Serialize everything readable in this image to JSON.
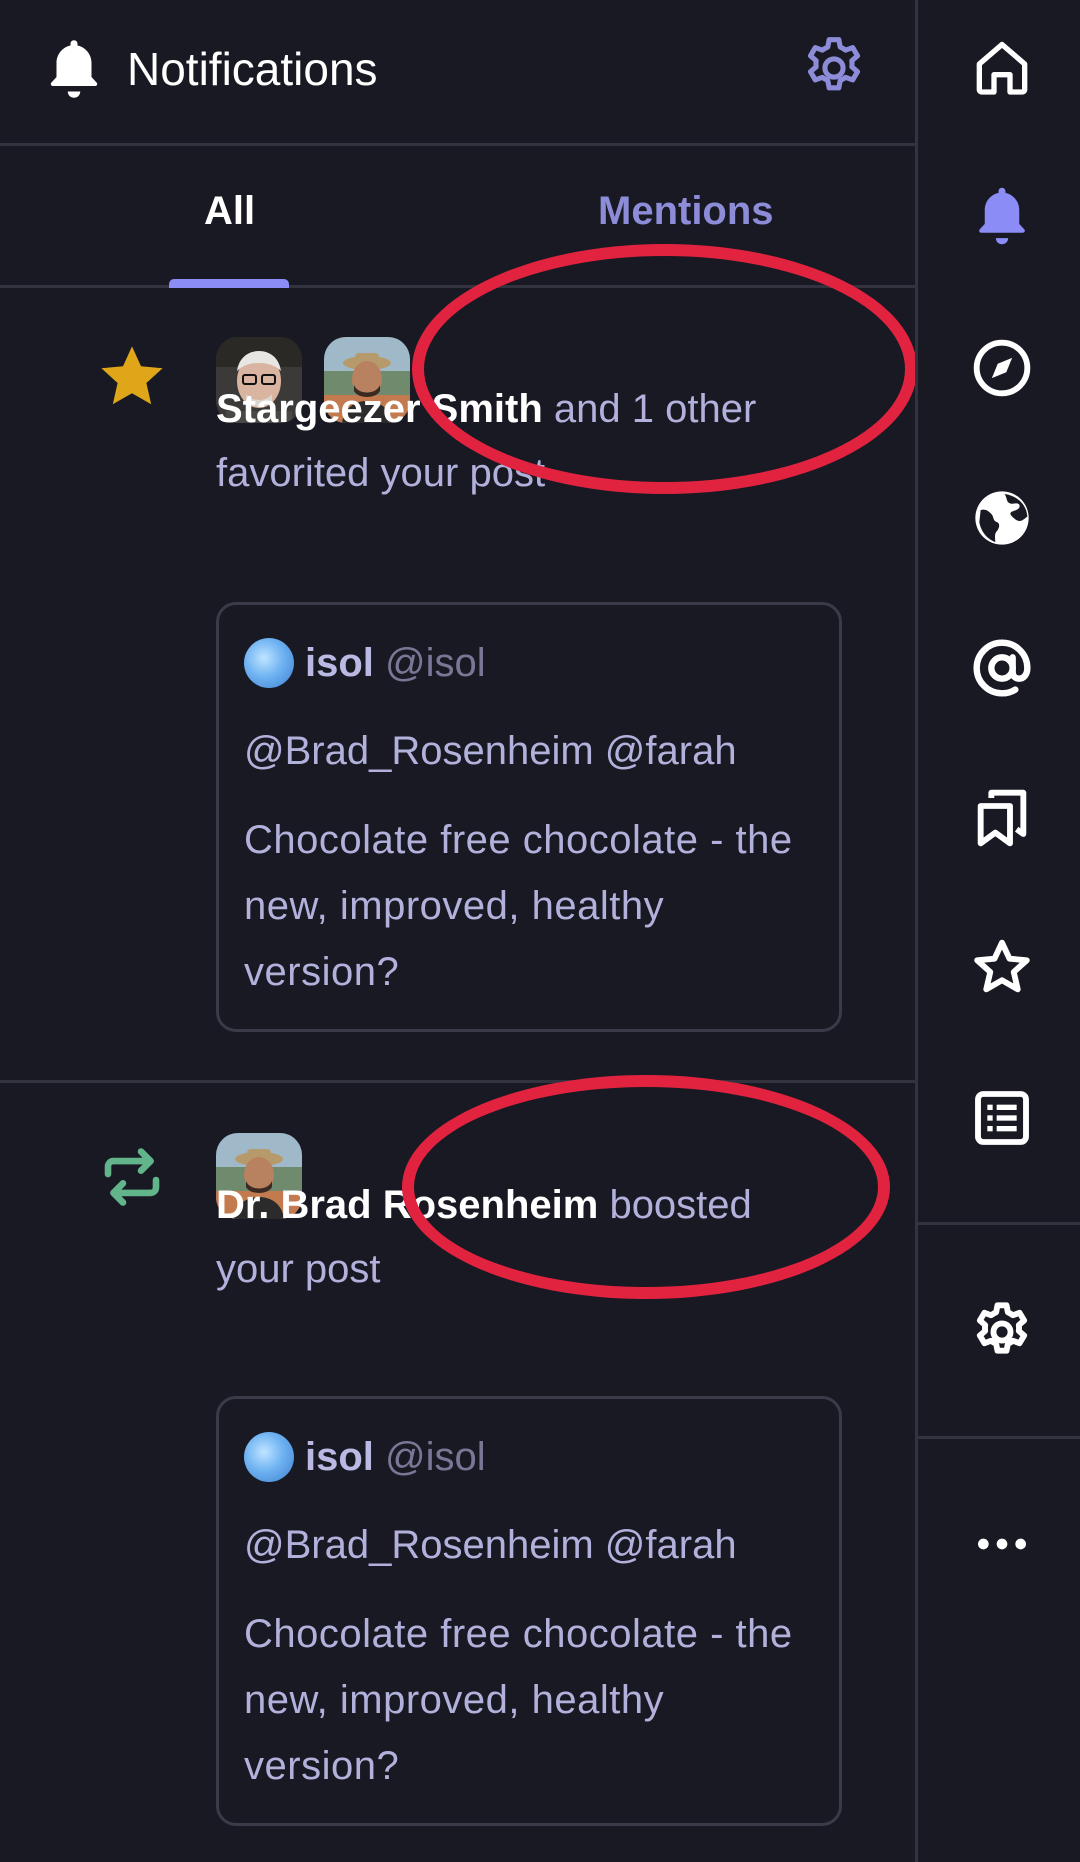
{
  "header": {
    "title": "Notifications",
    "bell_icon": "bell-icon",
    "settings_icon": "gear-icon"
  },
  "tabs": [
    {
      "label": "All",
      "selected": true
    },
    {
      "label": "Mentions",
      "selected": false
    }
  ],
  "notifications": [
    {
      "type": "favorite",
      "type_icon": "star-icon",
      "actor": "Stargeezer Smith",
      "action_rest": " and 1 other",
      "action_line2": "favorited your post",
      "post": {
        "display_name": "isol",
        "username": "@isol",
        "mentions": "@Brad_Rosenheim @farah",
        "text": "Chocolate free chocolate - the new, improved, healthy version?"
      }
    },
    {
      "type": "boost",
      "type_icon": "boost-icon",
      "actor": "Dr. Brad Rosenheim",
      "action_rest": " boosted",
      "action_line2": "your post",
      "post": {
        "display_name": "isol",
        "username": "@isol",
        "mentions": "@Brad_Rosenheim @farah",
        "text": "Chocolate free chocolate - the new, improved, healthy version?"
      }
    }
  ],
  "rail": {
    "items": [
      {
        "icon": "home-icon",
        "active": false
      },
      {
        "icon": "bell-icon",
        "active": true
      },
      {
        "icon": "compass-icon",
        "active": false
      },
      {
        "icon": "globe-icon",
        "active": false
      },
      {
        "icon": "at-icon",
        "active": false
      },
      {
        "icon": "bookmarks-icon",
        "active": false
      },
      {
        "icon": "star-icon",
        "active": false
      },
      {
        "icon": "list-icon",
        "active": false
      },
      {
        "icon": "gear-icon",
        "active": false
      },
      {
        "icon": "more-icon",
        "active": false
      }
    ]
  },
  "colors": {
    "background": "#191923",
    "accent": "#8c8cf6",
    "muted_text": "#b1b1dc",
    "favorite": "#e0a61a",
    "boost": "#62b58a",
    "annotation": "#e2233f"
  }
}
